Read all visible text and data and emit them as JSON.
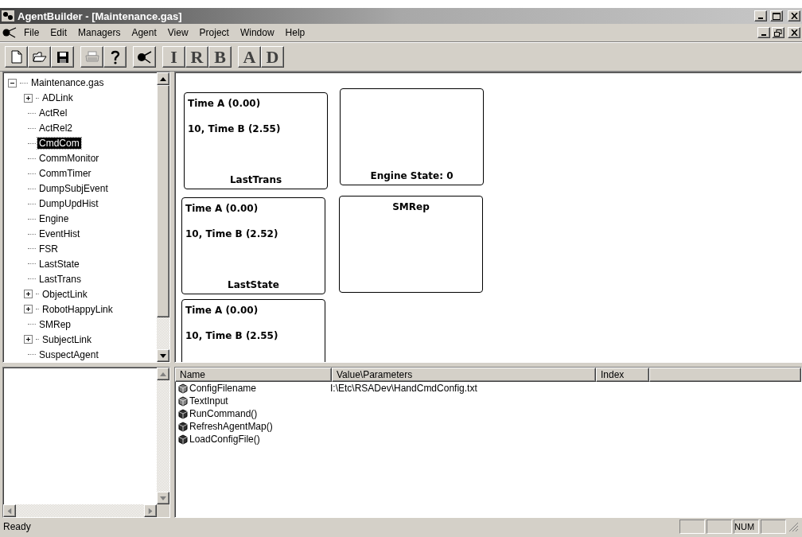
{
  "window": {
    "title": "AgentBuilder - [Maintenance.gas]"
  },
  "menu": [
    "File",
    "Edit",
    "Managers",
    "Agent",
    "View",
    "Project",
    "Window",
    "Help"
  ],
  "toolbar": [
    [
      {
        "kind": "new",
        "disabled": false
      },
      {
        "kind": "open",
        "disabled": false
      },
      {
        "kind": "save",
        "disabled": false
      }
    ],
    [
      {
        "kind": "print",
        "disabled": true
      },
      {
        "kind": "help",
        "disabled": false
      }
    ],
    [
      {
        "kind": "agent",
        "disabled": false
      }
    ],
    [
      {
        "kind": "letter",
        "label": "I",
        "disabled": false
      },
      {
        "kind": "letter",
        "label": "R",
        "disabled": false
      },
      {
        "kind": "letter",
        "label": "B",
        "disabled": false
      }
    ],
    [
      {
        "kind": "letter",
        "label": "A",
        "disabled": false
      },
      {
        "kind": "letter",
        "label": "D",
        "disabled": false
      }
    ]
  ],
  "tree": {
    "label": "Maintenance.gas",
    "expanded": true,
    "selected": false,
    "children": [
      {
        "label": "ADLink",
        "expanded": false,
        "selected": false
      },
      {
        "label": "ActRel",
        "selected": false
      },
      {
        "label": "ActRel2",
        "selected": false
      },
      {
        "label": "CmdCom",
        "selected": true
      },
      {
        "label": "CommMonitor",
        "selected": false
      },
      {
        "label": "CommTimer",
        "selected": false
      },
      {
        "label": "DumpSubjEvent",
        "selected": false
      },
      {
        "label": "DumpUpdHist",
        "selected": false
      },
      {
        "label": "Engine",
        "selected": false
      },
      {
        "label": "EventHist",
        "selected": false
      },
      {
        "label": "FSR",
        "selected": false
      },
      {
        "label": "LastState",
        "selected": false
      },
      {
        "label": "LastTrans",
        "selected": false
      },
      {
        "label": "ObjectLink",
        "expanded": false,
        "selected": false
      },
      {
        "label": "RobotHappyLink",
        "expanded": false,
        "selected": false
      },
      {
        "label": "SMRep",
        "selected": false
      },
      {
        "label": "SubjectLink",
        "expanded": false,
        "selected": false
      },
      {
        "label": "SuspectAgent",
        "selected": false
      }
    ]
  },
  "canvas": {
    "cards": [
      {
        "lines": [
          "Time A (0.00)",
          "10, Time B (2.55)"
        ],
        "footer": "LastTrans"
      },
      {
        "footer": "Engine State: 0"
      },
      {
        "lines": [
          "Time A (0.00)",
          "10, Time B (2.52)"
        ],
        "footer": "LastState"
      },
      {
        "header": "SMRep"
      },
      {
        "lines": [
          "Time A (0.00)",
          "10, Time B (2.55)"
        ]
      }
    ]
  },
  "table": {
    "columns": [
      "Name",
      "Value\\Parameters",
      "Index"
    ],
    "rows": [
      {
        "kind": "property",
        "name": "ConfigFilename",
        "value": "I:\\Etc\\RSADev\\HandCmdConfig.txt"
      },
      {
        "kind": "property",
        "name": "TextInput"
      },
      {
        "kind": "method",
        "name": "RunCommand()"
      },
      {
        "kind": "method",
        "name": "RefreshAgentMap()"
      },
      {
        "kind": "method",
        "name": "LoadConfigFile()"
      }
    ]
  },
  "status_bar": {
    "message": "Ready",
    "indicator": "NUM"
  }
}
